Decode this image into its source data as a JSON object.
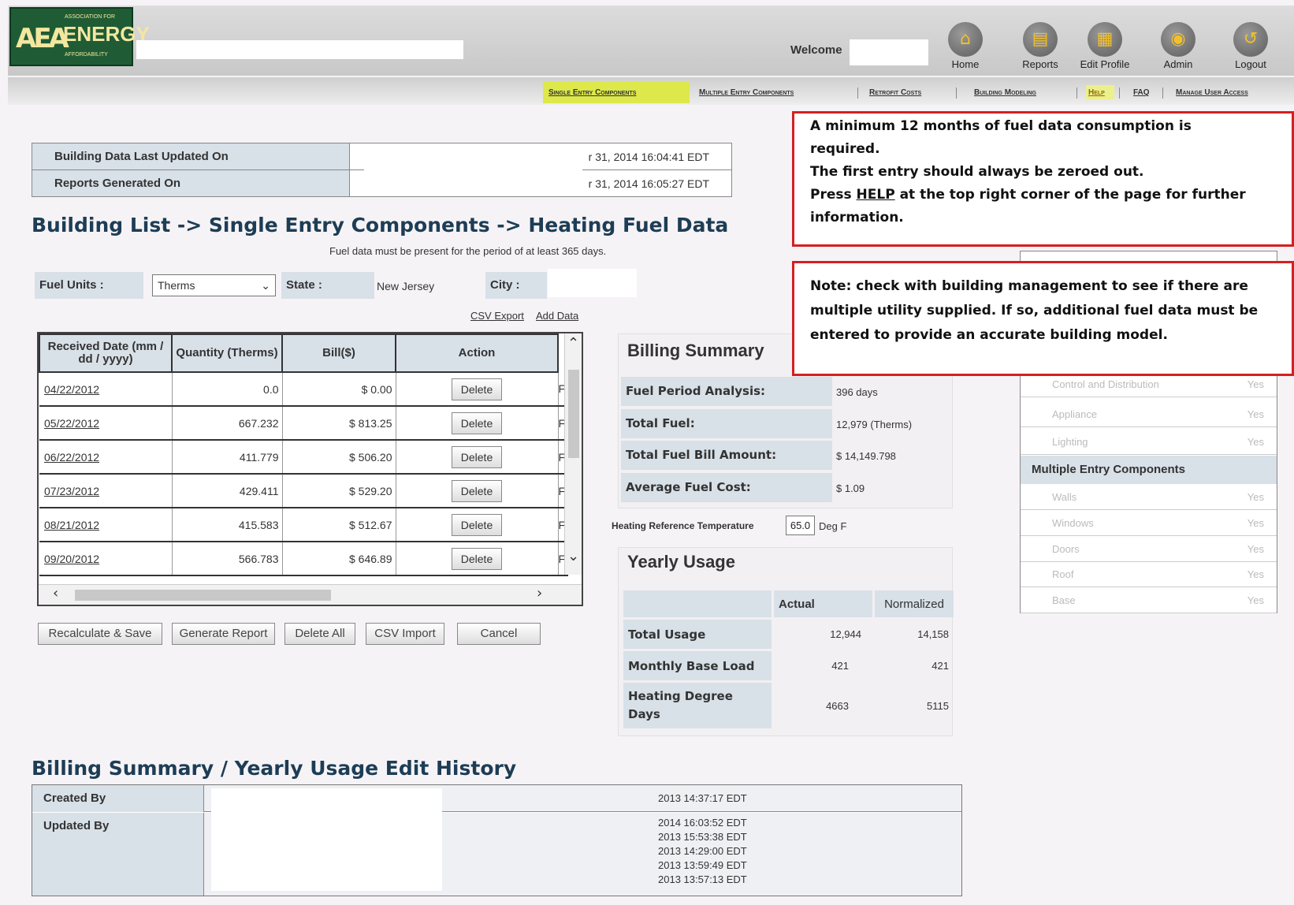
{
  "logo": {
    "line1": "ASSOCIATION FOR",
    "line2": "ENERGY",
    "line3": "AFFORDABILITY",
    "mark": "AEA"
  },
  "header": {
    "welcome": "Welcome",
    "nav": [
      {
        "label": "Home",
        "icon": "home-icon",
        "glyph": "⌂"
      },
      {
        "label": "Reports",
        "icon": "reports-icon",
        "glyph": "▤"
      },
      {
        "label": "Edit Profile",
        "icon": "edit-profile-icon",
        "glyph": "▦"
      },
      {
        "label": "Admin",
        "icon": "admin-icon",
        "glyph": "◉"
      },
      {
        "label": "Logout",
        "icon": "logout-icon",
        "glyph": "↺"
      }
    ]
  },
  "subnav": [
    "Single Entry Components",
    "Multiple Entry Components",
    "Retrofit Costs",
    "Building Modeling",
    "Help",
    "FAQ",
    "Manage User Access"
  ],
  "info": {
    "updated_label": "Building Data Last Updated On",
    "updated_value": "r 31, 2014 16:04:41 EDT",
    "generated_label": "Reports Generated On",
    "generated_value": "r 31, 2014 16:05:27 EDT"
  },
  "page_title": "Building List -> Single Entry Components -> Heating Fuel Data",
  "subtitle": "Fuel data must be present for the period of at least 365 days.",
  "filters": {
    "fuel_units_label": "Fuel Units :",
    "fuel_units_value": "Therms",
    "state_label": "State :",
    "state_value": "New Jersey",
    "city_label": "City :"
  },
  "links": {
    "csv_export": "CSV Export",
    "add_data": "Add Data"
  },
  "grid": {
    "headers": [
      "Received Date (mm / dd / yyyy)",
      "Quantity (Therms)",
      "Bill($)",
      "Action"
    ],
    "rows": [
      {
        "date": "04/22/2012",
        "qty": "0.0",
        "bill": "$ 0.00",
        "action": "Delete",
        "trail": "F"
      },
      {
        "date": "05/22/2012",
        "qty": "667.232",
        "bill": "$ 813.25",
        "action": "Delete",
        "trail": "F"
      },
      {
        "date": "06/22/2012",
        "qty": "411.779",
        "bill": "$ 506.20",
        "action": "Delete",
        "trail": "F"
      },
      {
        "date": "07/23/2012",
        "qty": "429.411",
        "bill": "$ 529.20",
        "action": "Delete",
        "trail": "F"
      },
      {
        "date": "08/21/2012",
        "qty": "415.583",
        "bill": "$ 512.67",
        "action": "Delete",
        "trail": "F"
      },
      {
        "date": "09/20/2012",
        "qty": "566.783",
        "bill": "$ 646.89",
        "action": "Delete",
        "trail": "F"
      }
    ]
  },
  "buttons": [
    "Recalculate & Save",
    "Generate Report",
    "Delete All",
    "CSV Import",
    "Cancel"
  ],
  "billing": {
    "title": "Billing Summary",
    "rows": [
      {
        "label": "Fuel Period Analysis:",
        "value": "396 days"
      },
      {
        "label": "Total Fuel:",
        "value": "12,979 (Therms)"
      },
      {
        "label": "Total Fuel Bill Amount:",
        "value": "$ 14,149.798"
      },
      {
        "label": "Average Fuel Cost:",
        "value": "$ 1.09"
      }
    ],
    "ref_temp_label": "Heating Reference Temperature",
    "ref_temp_value": "65.0",
    "ref_temp_unit": "Deg F"
  },
  "yearly": {
    "title": "Yearly Usage",
    "col_actual": "Actual",
    "col_normalized": "Normalized",
    "rows": [
      {
        "label": "Total Usage",
        "actual": "12,944",
        "normalized": "14,158"
      },
      {
        "label": "Monthly Base Load",
        "actual": "421",
        "normalized": "421"
      },
      {
        "label": "Heating Degree Days",
        "actual": "4663",
        "normalized": "5115"
      }
    ]
  },
  "right_list": {
    "top_items": [
      {
        "name": "Control and Distribution",
        "status": "Yes"
      },
      {
        "name": "Appliance",
        "status": "Yes"
      },
      {
        "name": "Lighting",
        "status": "Yes"
      }
    ],
    "multiple_title": "Multiple Entry Components",
    "multiple_items": [
      {
        "name": "Walls",
        "status": "Yes"
      },
      {
        "name": "Windows",
        "status": "Yes"
      },
      {
        "name": "Doors",
        "status": "Yes"
      },
      {
        "name": "Roof",
        "status": "Yes"
      },
      {
        "name": "Base",
        "status": "Yes"
      }
    ]
  },
  "callout1": {
    "l1": "A minimum 12 months of fuel data consumption is",
    "l2": "required.",
    "l3": "The first entry should always be zeroed out.",
    "l4a": "Press ",
    "l4link": "HELP",
    "l4b": " at the top right corner of the page for further",
    "l5": "information."
  },
  "callout2": {
    "l1": "Note: check with building management to see if there are",
    "l2": "multiple utility supplied.  If so, additional fuel data must be",
    "l3": "entered to provide an accurate building model."
  },
  "history": {
    "title": "Billing Summary / Yearly Usage Edit History",
    "created_label": "Created By",
    "created_value": "2013 14:37:17 EDT",
    "updated_label": "Updated By",
    "updated_values": [
      "2014 16:03:52 EDT",
      "2013 15:53:38 EDT",
      "2013 14:29:00 EDT",
      "2013 13:59:49 EDT",
      "2013 13:57:13 EDT"
    ]
  },
  "colors": {
    "accent_green": "#1f5c35",
    "highlight": "#dde84a",
    "callout_border": "#d42020",
    "label_bg": "#d8e0e8"
  }
}
